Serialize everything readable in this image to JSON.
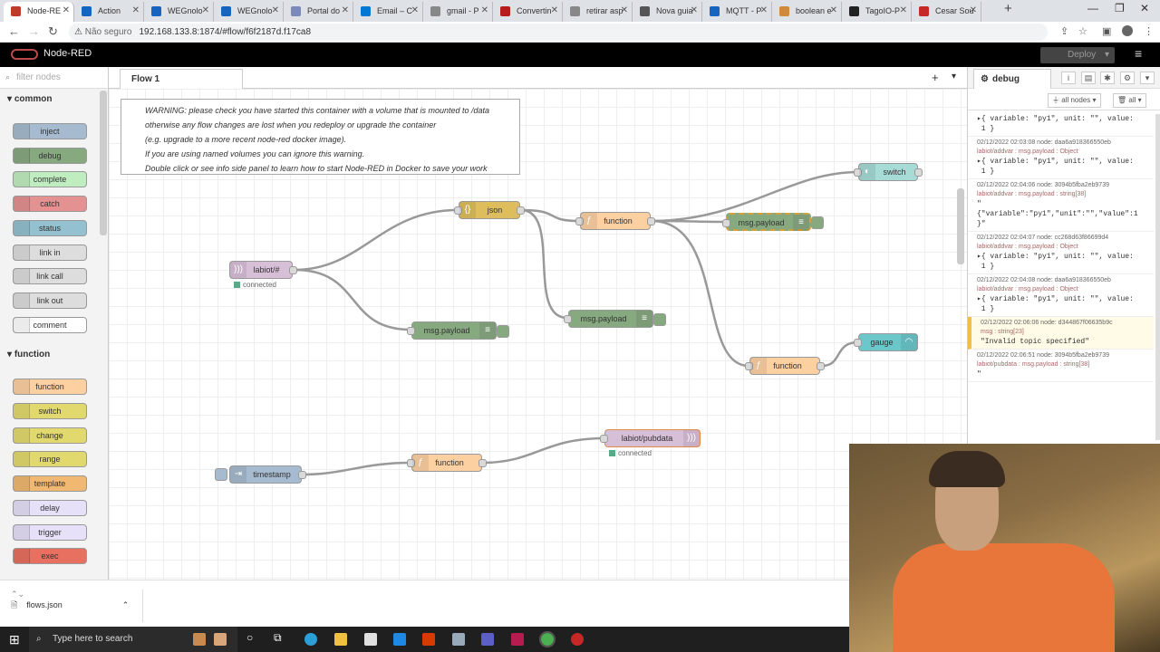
{
  "browser": {
    "tabs": [
      {
        "title": "Node-RE",
        "color": "#c0392b"
      },
      {
        "title": "Action",
        "color": "#1565c0"
      },
      {
        "title": "WEGnolo",
        "color": "#1565c0"
      },
      {
        "title": "WEGnolo",
        "color": "#1565c0"
      },
      {
        "title": "Portal do",
        "color": "#7b8ab8"
      },
      {
        "title": "Email – C",
        "color": "#0078d4"
      },
      {
        "title": "gmail - P",
        "color": "#888888"
      },
      {
        "title": "Convertin",
        "color": "#b71c1c"
      },
      {
        "title": "retirar asp",
        "color": "#888888"
      },
      {
        "title": "Nova guia",
        "color": "#555555"
      },
      {
        "title": "MQTT - P",
        "color": "#1565c0"
      },
      {
        "title": "boolean e",
        "color": "#d08a3a"
      },
      {
        "title": "TagoIO-P",
        "color": "#222222"
      },
      {
        "title": "Cesar Sou",
        "color": "#c62828"
      }
    ],
    "security": "Não seguro",
    "url": "192.168.133.8:1874/#flow/f6f2187d.f17ca8"
  },
  "app": {
    "title": "Node-RED",
    "deploy_label": "Deploy"
  },
  "palette": {
    "filter_placeholder": "filter nodes",
    "categories": [
      {
        "name": "common",
        "nodes": [
          {
            "label": "inject",
            "color": "#a6bbcf"
          },
          {
            "label": "debug",
            "color": "#87a980"
          },
          {
            "label": "complete",
            "color": "#c0edc0"
          },
          {
            "label": "catch",
            "color": "#e49191"
          },
          {
            "label": "status",
            "color": "#94c1d0"
          },
          {
            "label": "link in",
            "color": "#dddddd"
          },
          {
            "label": "link call",
            "color": "#dddddd"
          },
          {
            "label": "link out",
            "color": "#dddddd"
          },
          {
            "label": "comment",
            "color": "#ffffff"
          }
        ]
      },
      {
        "name": "function",
        "nodes": [
          {
            "label": "function",
            "color": "#fdd0a2"
          },
          {
            "label": "switch",
            "color": "#e2d96e"
          },
          {
            "label": "change",
            "color": "#e2d96e"
          },
          {
            "label": "range",
            "color": "#e2d96e"
          },
          {
            "label": "template",
            "color": "#f0b870"
          },
          {
            "label": "delay",
            "color": "#e6e0f8"
          },
          {
            "label": "trigger",
            "color": "#e6e0f8"
          },
          {
            "label": "exec",
            "color": "#e87060"
          }
        ]
      }
    ]
  },
  "workspace": {
    "flow_tab": "Flow 1",
    "warning": [
      "WARNING: please check you have started this container with a volume that is mounted to /data",
      "otherwise any flow changes are lost when you redeploy or upgrade the container",
      "(e.g. upgrade to a more recent node-red docker image).",
      "If you are using named volumes you can ignore this warning.",
      "Double click or see info side panel to learn how to start Node-RED in Docker to save your work"
    ],
    "nodes": {
      "mqtt_in": "labiot/#",
      "mqtt_in_status": "connected",
      "json": "json",
      "function1": "function",
      "switch": "switch",
      "debug1": "msg.payload",
      "debug2": "msg.payload",
      "debug3": "msg.payload",
      "function2": "function",
      "gauge": "gauge",
      "timestamp": "timestamp",
      "function3": "function",
      "mqtt_out": "labiot/pubdata",
      "mqtt_out_status": "connected"
    }
  },
  "sidebar": {
    "tab": "debug",
    "filter_nodes": "all nodes",
    "clear": "all",
    "messages": [
      {
        "meta": "",
        "topic": "",
        "value": "▸{ variable: \"py1\", unit: \"\", value:\n 1 }"
      },
      {
        "meta": "02/12/2022 02:03:08   node: daa6a918366550eb",
        "topic": "labiot/addvar : msg.payload : Object",
        "value": "▸{ variable: \"py1\", unit: \"\", value:\n 1 }"
      },
      {
        "meta": "02/12/2022 02:04:06   node: 3094b5fba2eb9739",
        "topic": "labiot/addvar : msg.payload : string[38]",
        "value": "\"\n{\"variable\":\"py1\",\"unit\":\"\",\"value\":1\n}\""
      },
      {
        "meta": "02/12/2022 02:04:07   node: cc268d63f86699d4",
        "topic": "labiot/addvar : msg.payload : Object",
        "value": "▸{ variable: \"py1\", unit: \"\", value:\n 1 }"
      },
      {
        "meta": "02/12/2022 02:04:08   node: daa6a918366550eb",
        "topic": "labiot/addvar : msg.payload : Object",
        "value": "▸{ variable: \"py1\", unit: \"\", value:\n 1 }"
      },
      {
        "meta": "02/12/2022 02:06:06   node: d344867f06635b9c",
        "topic": "msg : string[23]",
        "value": "\"Invalid topic specified\"",
        "warn": true
      },
      {
        "meta": "02/12/2022 02:06:51   node: 3094b5fba2eb9739",
        "topic": "labiot/pubdata : msg.payload : string[38]",
        "value": "\""
      }
    ]
  },
  "bottom": {
    "download": "flows.json"
  },
  "taskbar": {
    "search_placeholder": "Type here to search"
  }
}
